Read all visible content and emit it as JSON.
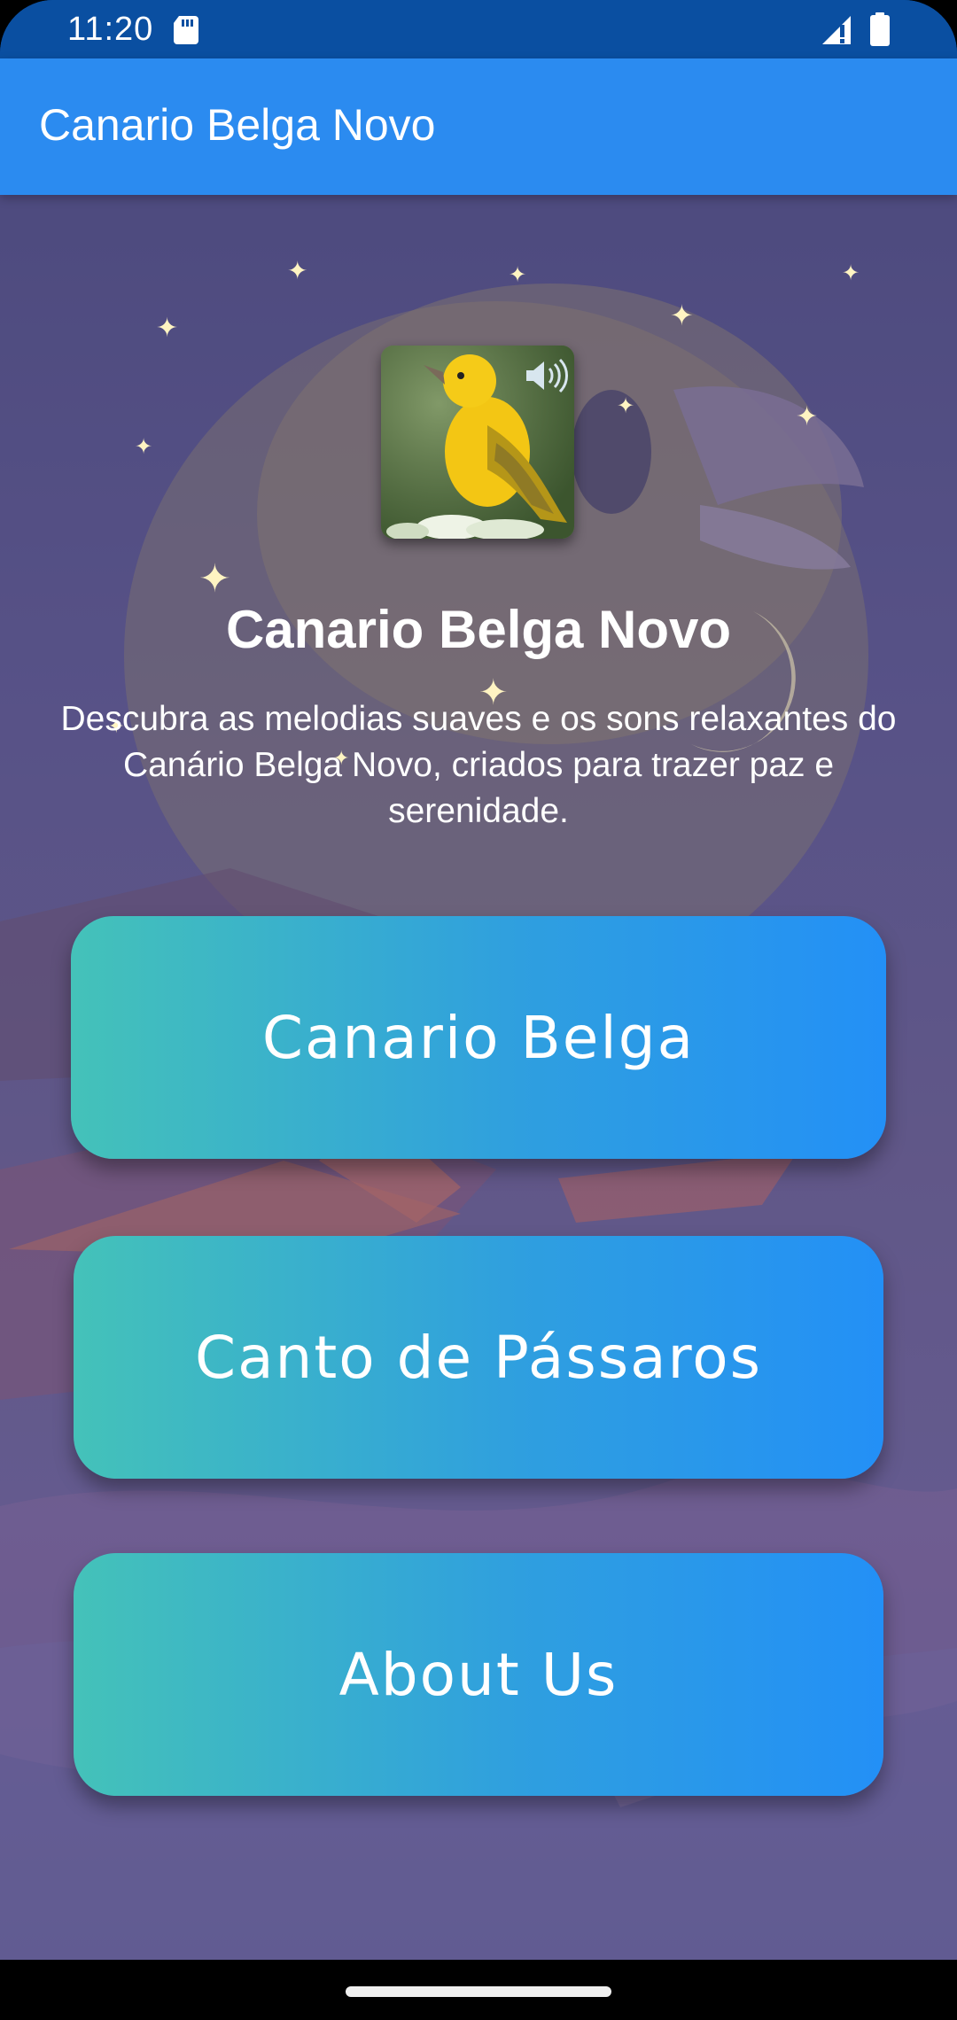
{
  "status_bar": {
    "time": "11:20",
    "icons": [
      "sd-card-icon",
      "signal-icon",
      "battery-icon"
    ]
  },
  "app_bar": {
    "title": "Canario Belga Novo",
    "color": "#2b8bf0"
  },
  "hero": {
    "image_icon": "canary-bird-thumbnail",
    "sound_icon": "speaker-icon",
    "title": "Canario Belga Novo",
    "description": "Descubra as melodias suaves e os sons relaxantes do Canário Belga Novo, criados para trazer paz e serenidade."
  },
  "menu": {
    "buttons": [
      {
        "label": "Canario Belga"
      },
      {
        "label": "Canto de Pássaros"
      },
      {
        "label": "About Us"
      }
    ],
    "gradient_start": "#44c2b9",
    "gradient_end": "#2390f6"
  },
  "colors": {
    "status_bar": "#0a4fa1",
    "background": "#5c5585"
  }
}
